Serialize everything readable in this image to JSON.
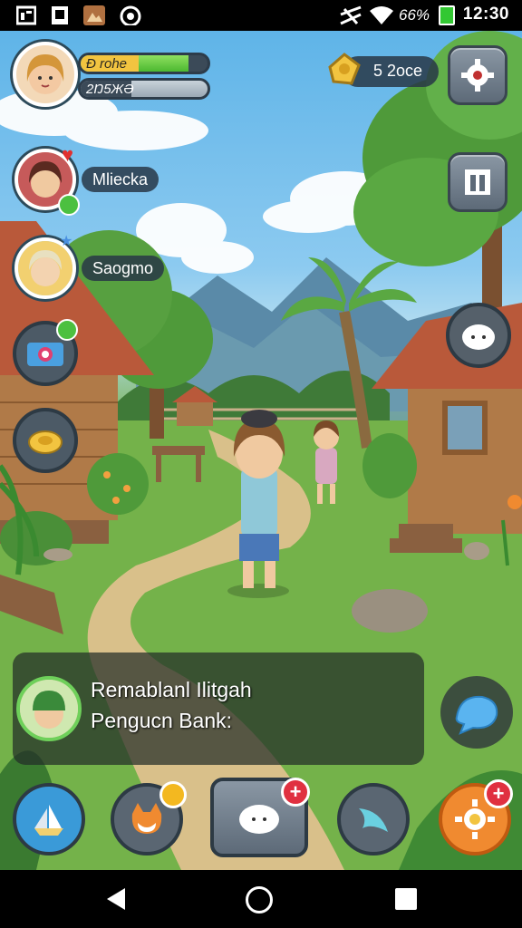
{
  "status_bar": {
    "battery_text": "66%",
    "time": "12:30"
  },
  "player": {
    "name_tag": "Đ rohe",
    "xp_fraction": 0.85,
    "secondary_value": "2Ŋ5ЖӘ"
  },
  "currency": {
    "amount": "5 2oce"
  },
  "npcs": [
    {
      "name": "Mliecka"
    },
    {
      "name": "Saogmo"
    }
  ],
  "dialog": {
    "line1": "Remablanl Ilitgah",
    "line2": "Pengucn Bank:"
  },
  "colors": {
    "accent_green": "#4cb830",
    "gold": "#f2c440",
    "alert_red": "#e03040",
    "hud_dark": "#2d3c4a"
  },
  "icons": {
    "settings": "gear-icon",
    "inventory": "book-icon",
    "pet": "cat-icon",
    "camera": "camera-icon",
    "food": "food-icon",
    "chat": "speech-bird-icon",
    "sun": "sun-icon"
  }
}
